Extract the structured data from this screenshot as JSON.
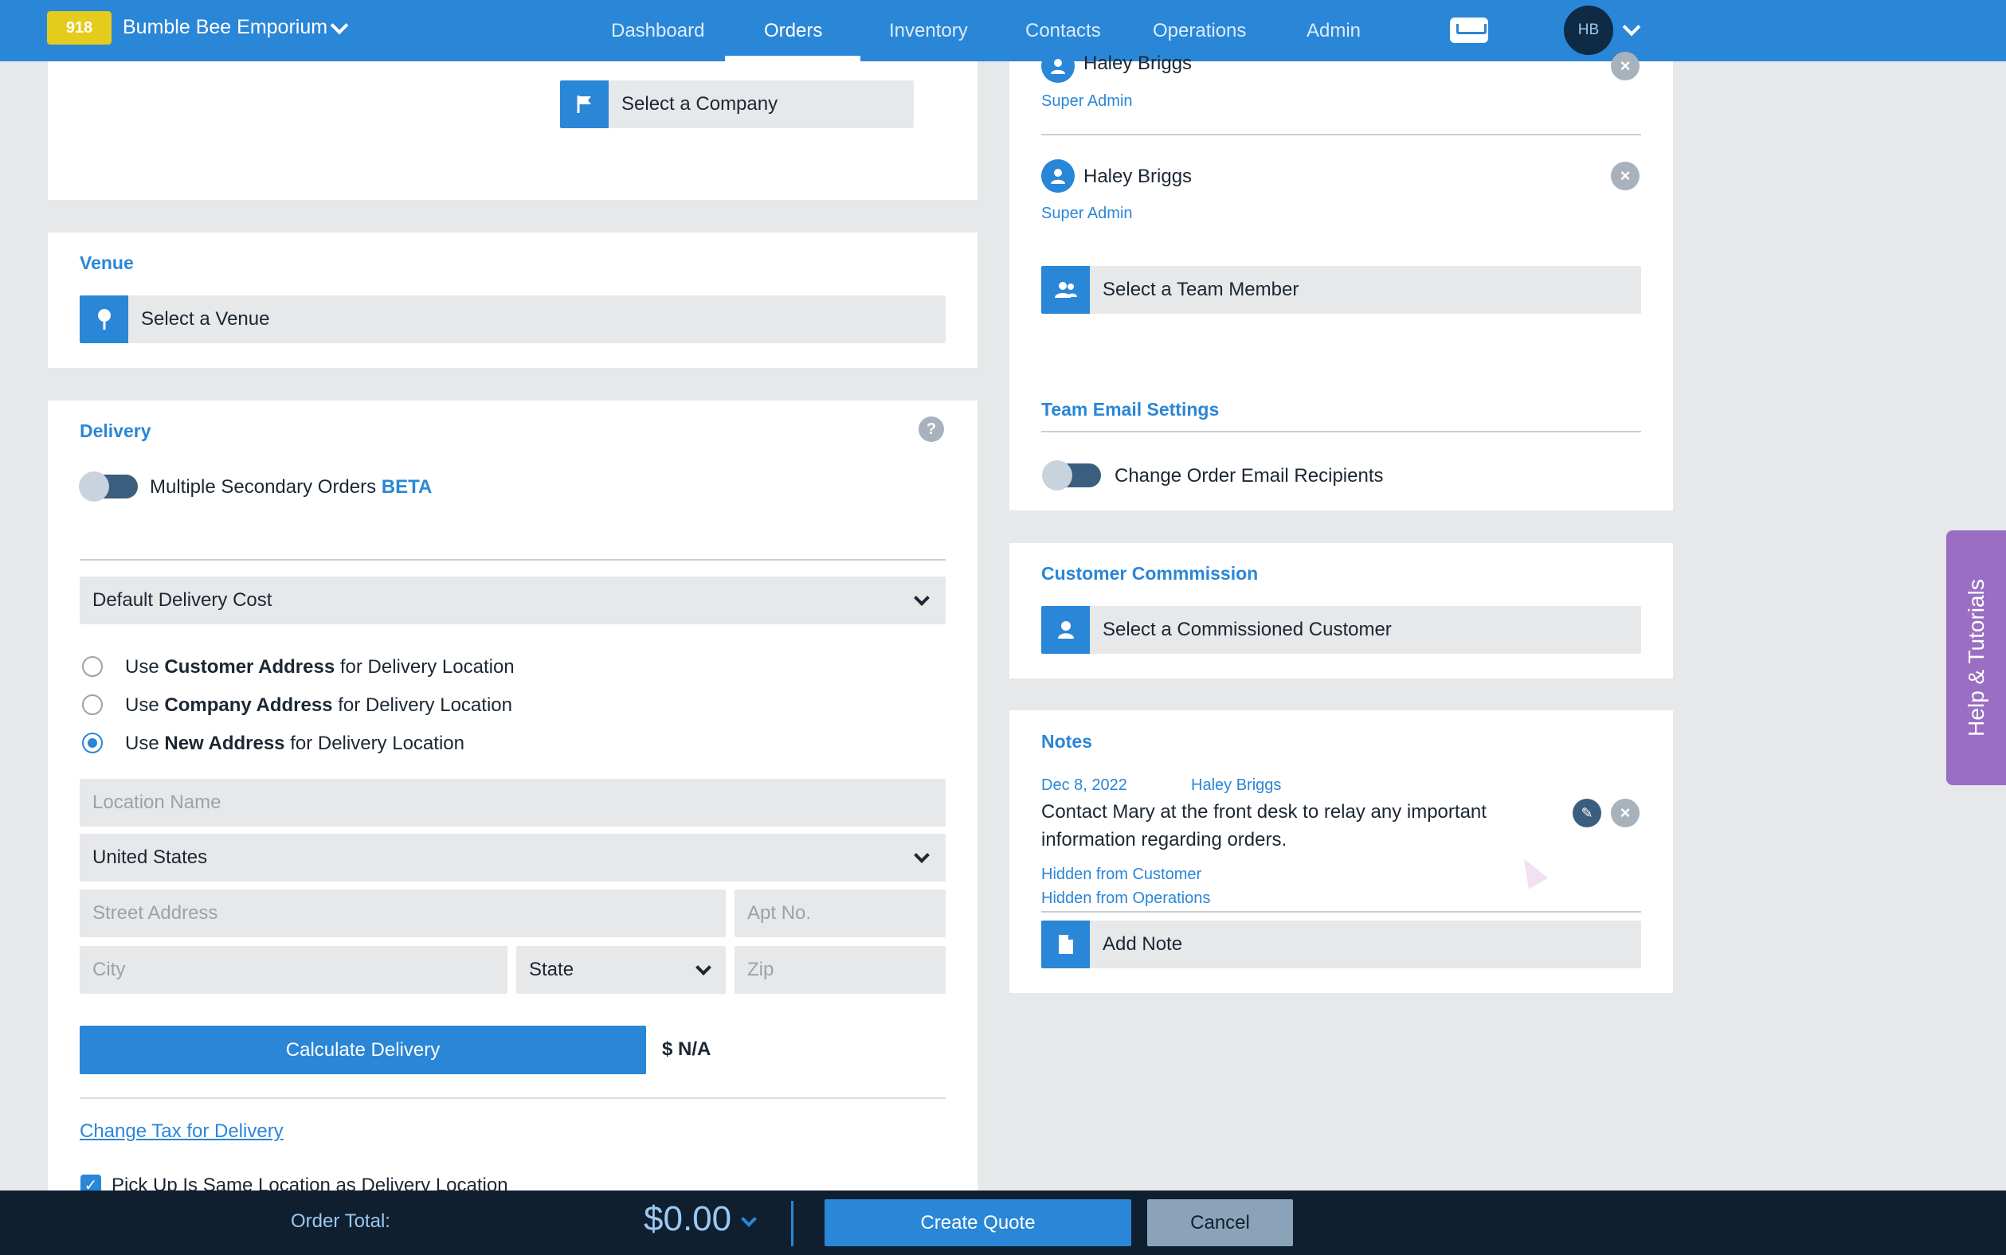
{
  "header": {
    "badge": "918",
    "company": "Bumble Bee Emporium",
    "nav": [
      "Dashboard",
      "Orders",
      "Inventory",
      "Contacts",
      "Operations",
      "Admin"
    ],
    "active_nav": "Orders",
    "avatar_initials": "HB"
  },
  "company_select": {
    "label": "Select a Company"
  },
  "venue": {
    "title": "Venue",
    "select_label": "Select a Venue"
  },
  "delivery": {
    "title": "Delivery",
    "help": "?",
    "multiple_secondary_label": "Multiple Secondary Orders",
    "beta": "BETA",
    "delivery_cost": "Default Delivery Cost",
    "radios": [
      {
        "pre": "Use ",
        "bold": "Customer Address",
        "post": " for Delivery Location",
        "checked": false
      },
      {
        "pre": "Use ",
        "bold": "Company Address",
        "post": " for Delivery Location",
        "checked": false
      },
      {
        "pre": "Use ",
        "bold": "New Address",
        "post": " for Delivery Location",
        "checked": true
      }
    ],
    "location_name_placeholder": "Location Name",
    "country": "United States",
    "street_placeholder": "Street Address",
    "apt_placeholder": "Apt No.",
    "city_placeholder": "City",
    "state": "State",
    "zip_placeholder": "Zip",
    "calculate_button": "Calculate Delivery",
    "delivery_price": "$ N/A",
    "change_tax_link": "Change Tax for Delivery",
    "pickup_same_label": "Pick Up Is Same Location as Delivery Location",
    "pickup_same_checked": true
  },
  "team": {
    "members": [
      {
        "name": "Haley Briggs",
        "role": "Super Admin"
      },
      {
        "name": "Haley Briggs",
        "role": "Super Admin"
      }
    ],
    "select_member_label": "Select a Team Member",
    "email_settings_title": "Team Email Settings",
    "change_recipients_label": "Change Order Email Recipients"
  },
  "commission": {
    "title": "Customer Commmission",
    "select_label": "Select a Commissioned Customer"
  },
  "notes": {
    "title": "Notes",
    "items": [
      {
        "date": "Dec 8, 2022",
        "author": "Haley Briggs",
        "text_line1": "Contact Mary at the front desk to relay any important",
        "text_line2": "information regarding orders.",
        "flag1": "Hidden from Customer",
        "flag2": "Hidden from Operations"
      }
    ],
    "add_note_label": "Add Note"
  },
  "help_tab": "Help & Tutorials",
  "footer": {
    "order_total_label": "Order Total:",
    "order_total_value": "$0.00",
    "create_quote": "Create Quote",
    "cancel": "Cancel"
  }
}
